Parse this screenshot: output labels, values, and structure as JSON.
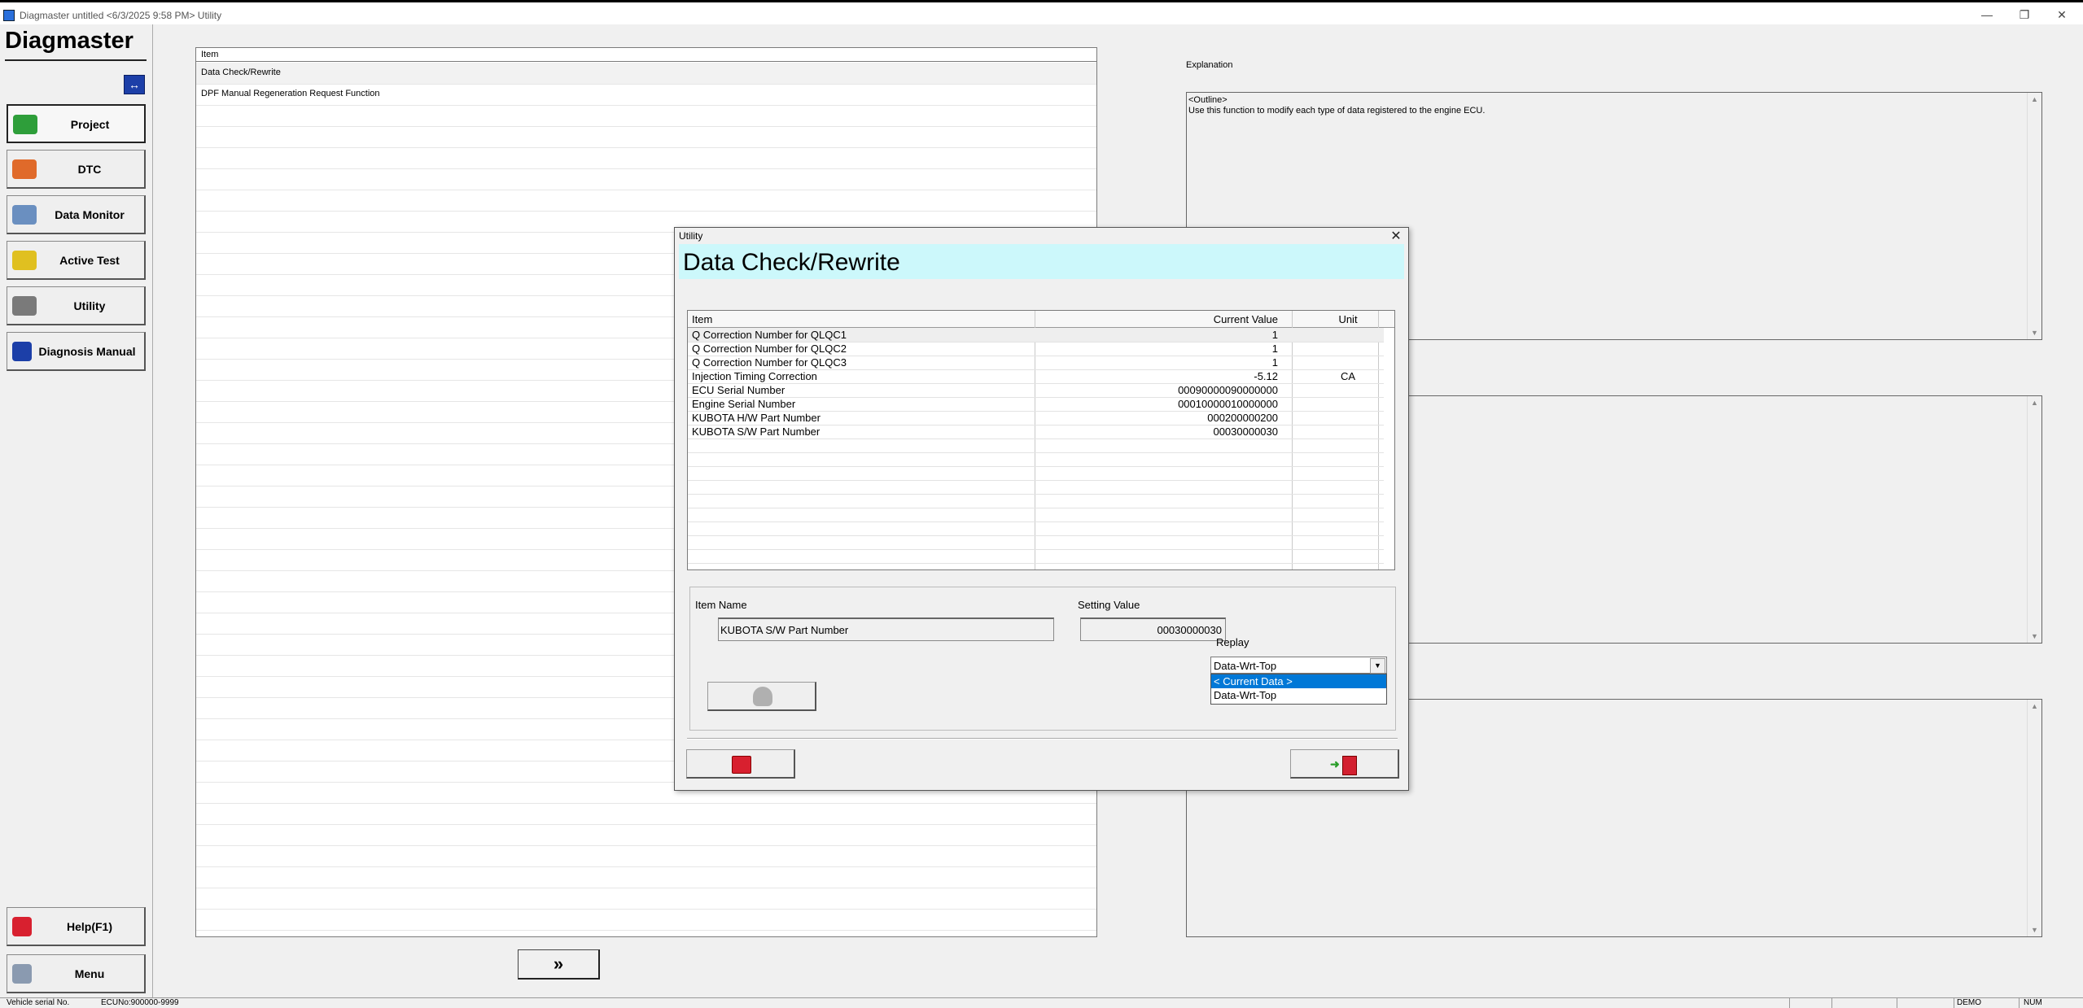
{
  "window": {
    "title": "Diagmaster untitled <6/3/2025 9:58 PM> Utility",
    "minimize": "—",
    "maximize": "❐",
    "close": "✕"
  },
  "sidebar": {
    "logo": "Diagmaster",
    "swap_icon": "↔",
    "items": [
      {
        "label": "Project",
        "icon": "project-icon",
        "color": "#2e9e3a"
      },
      {
        "label": "DTC",
        "icon": "dtc-icon",
        "color": "#e06a2a"
      },
      {
        "label": "Data Monitor",
        "icon": "data-monitor-icon",
        "color": "#6a8fc0"
      },
      {
        "label": "Active Test",
        "icon": "active-test-icon",
        "color": "#e0c020"
      },
      {
        "label": "Utility",
        "icon": "utility-icon",
        "color": "#7a7a7a"
      },
      {
        "label": "Diagnosis Manual",
        "icon": "manual-icon",
        "color": "#1c3fa8"
      },
      {
        "label": "Help(F1)",
        "icon": "help-icon",
        "color": "#d8202f"
      },
      {
        "label": "Menu",
        "icon": "menu-icon",
        "color": "#8a9ab0"
      }
    ]
  },
  "item_list": {
    "header": "Item",
    "rows": [
      "Data Check/Rewrite",
      "DPF Manual Regeneration Request Function"
    ],
    "next_label": "»"
  },
  "explanation": {
    "label": "Explanation",
    "text": "<Outline>\nUse this function to modify each type of data registered to the engine ECU."
  },
  "dialog": {
    "window_title": "Utility",
    "close": "✕",
    "heading": "Data Check/Rewrite",
    "columns": {
      "item": "Item",
      "current_value": "Current Value",
      "unit": "Unit"
    },
    "rows": [
      {
        "item": "Q Correction Number for QLQC1",
        "value": "1",
        "unit": ""
      },
      {
        "item": "Q Correction Number for QLQC2",
        "value": "1",
        "unit": ""
      },
      {
        "item": "Q Correction Number for QLQC3",
        "value": "1",
        "unit": ""
      },
      {
        "item": "Injection Timing Correction",
        "value": "-5.12",
        "unit": "CA"
      },
      {
        "item": "ECU Serial Number",
        "value": "00090000090000000",
        "unit": ""
      },
      {
        "item": "Engine Serial Number",
        "value": "00010000010000000",
        "unit": ""
      },
      {
        "item": "KUBOTA H/W Part Number",
        "value": "000200000200",
        "unit": ""
      },
      {
        "item": "KUBOTA S/W Part Number",
        "value": "00030000030",
        "unit": ""
      }
    ],
    "item_name_label": "Item Name",
    "item_name_value": "KUBOTA S/W Part Number",
    "setting_value_label": "Setting Value",
    "setting_value": "00030000030",
    "replay_label": "Replay",
    "replay_selected": "Data-Wrt-Top",
    "replay_options": [
      "< Current Data >",
      "Data-Wrt-Top"
    ]
  },
  "statusbar": {
    "vehicle": "Vehicle serial No.",
    "ecu": "ECUNo:900000-9999",
    "demo": "DEMO",
    "num": "NUM"
  }
}
